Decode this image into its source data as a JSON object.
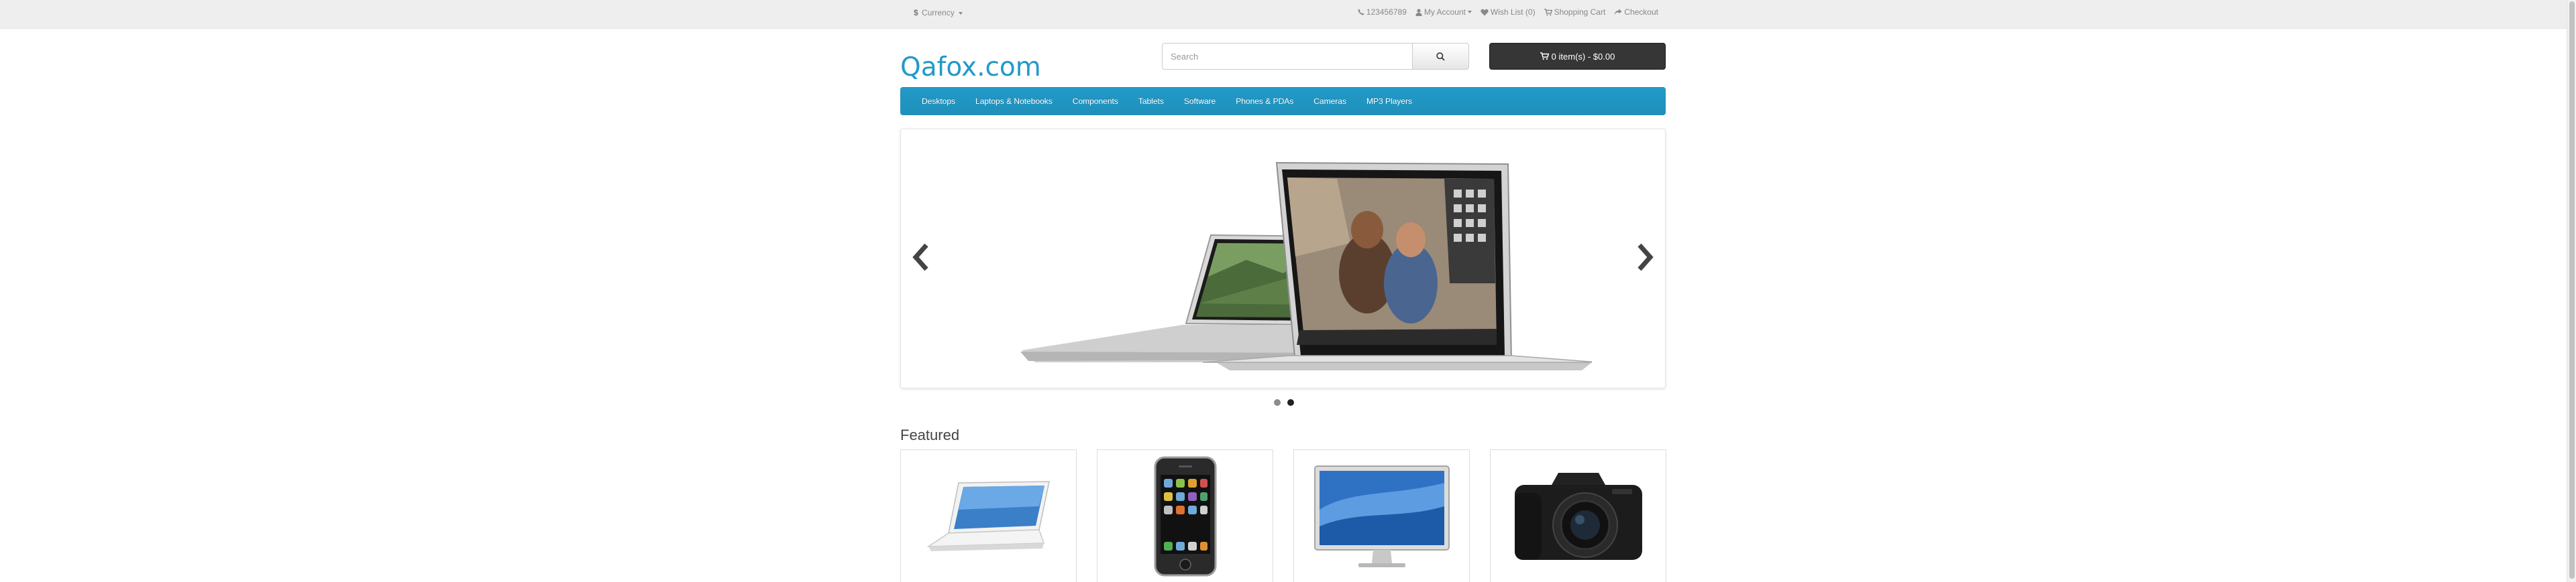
{
  "topbar": {
    "currency_symbol": "$",
    "currency_label": "Currency",
    "phone": "123456789",
    "my_account": "My Account",
    "wish_list": "Wish List (0)",
    "shopping_cart": "Shopping Cart",
    "checkout": "Checkout"
  },
  "header": {
    "logo": "Qafox.com",
    "search_placeholder": "Search",
    "cart_summary": "0 item(s) - $0.00"
  },
  "menu": {
    "items": [
      "Desktops",
      "Laptops & Notebooks",
      "Components",
      "Tablets",
      "Software",
      "Phones & PDAs",
      "Cameras",
      "MP3 Players"
    ]
  },
  "slideshow": {
    "slide_count": 2,
    "active_slide": 2
  },
  "featured": {
    "title": "Featured",
    "products": [
      {
        "image": "macbook-laptop-image"
      },
      {
        "image": "iphone-image"
      },
      {
        "image": "apple-cinema-display-image"
      },
      {
        "image": "canon-eos-camera-image"
      }
    ]
  },
  "colors": {
    "brand": "#229ac8",
    "menu_bg": "#229ac8",
    "cart_button_bg": "#363636",
    "topbar_bg": "#eeeeee"
  },
  "icons": [
    "phone-icon",
    "user-icon",
    "heart-icon",
    "cart-icon",
    "share-icon",
    "search-icon",
    "chevron-left-icon",
    "chevron-right-icon"
  ]
}
